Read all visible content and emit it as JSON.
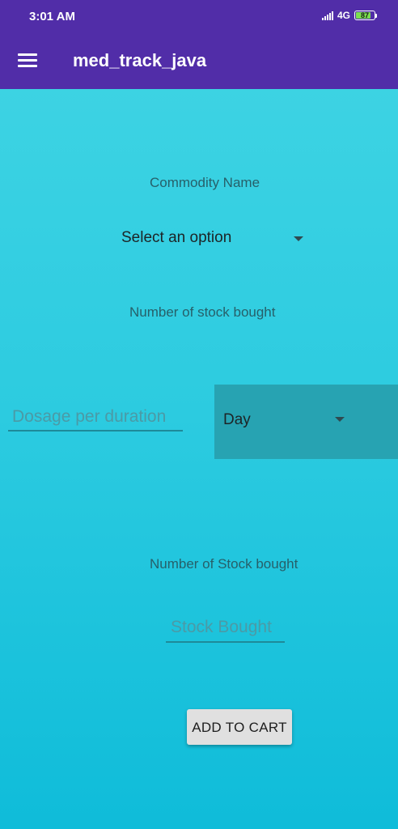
{
  "status_bar": {
    "time": "3:01 AM",
    "network": "4G",
    "battery": "87"
  },
  "app_bar": {
    "title": "med_track_java",
    "menu_icon": "hamburger-menu-icon"
  },
  "form": {
    "commodity_label": "Commodity Name",
    "commodity_select_value": "Select an option",
    "stock_bought_label_1": "Number of stock bought",
    "dosage_placeholder": "Dosage per duration",
    "duration_select_value": "Day",
    "stock_bought_label_2": "Number of Stock bought",
    "stock_placeholder": "Stock Bought",
    "add_button_label": "ADD TO CART"
  },
  "colors": {
    "primary": "#512da8",
    "background_top": "#41d5e4",
    "background_bottom": "#0fbcd9",
    "duration_select_bg": "#27a3b2",
    "button_bg": "#e0e0e0"
  }
}
